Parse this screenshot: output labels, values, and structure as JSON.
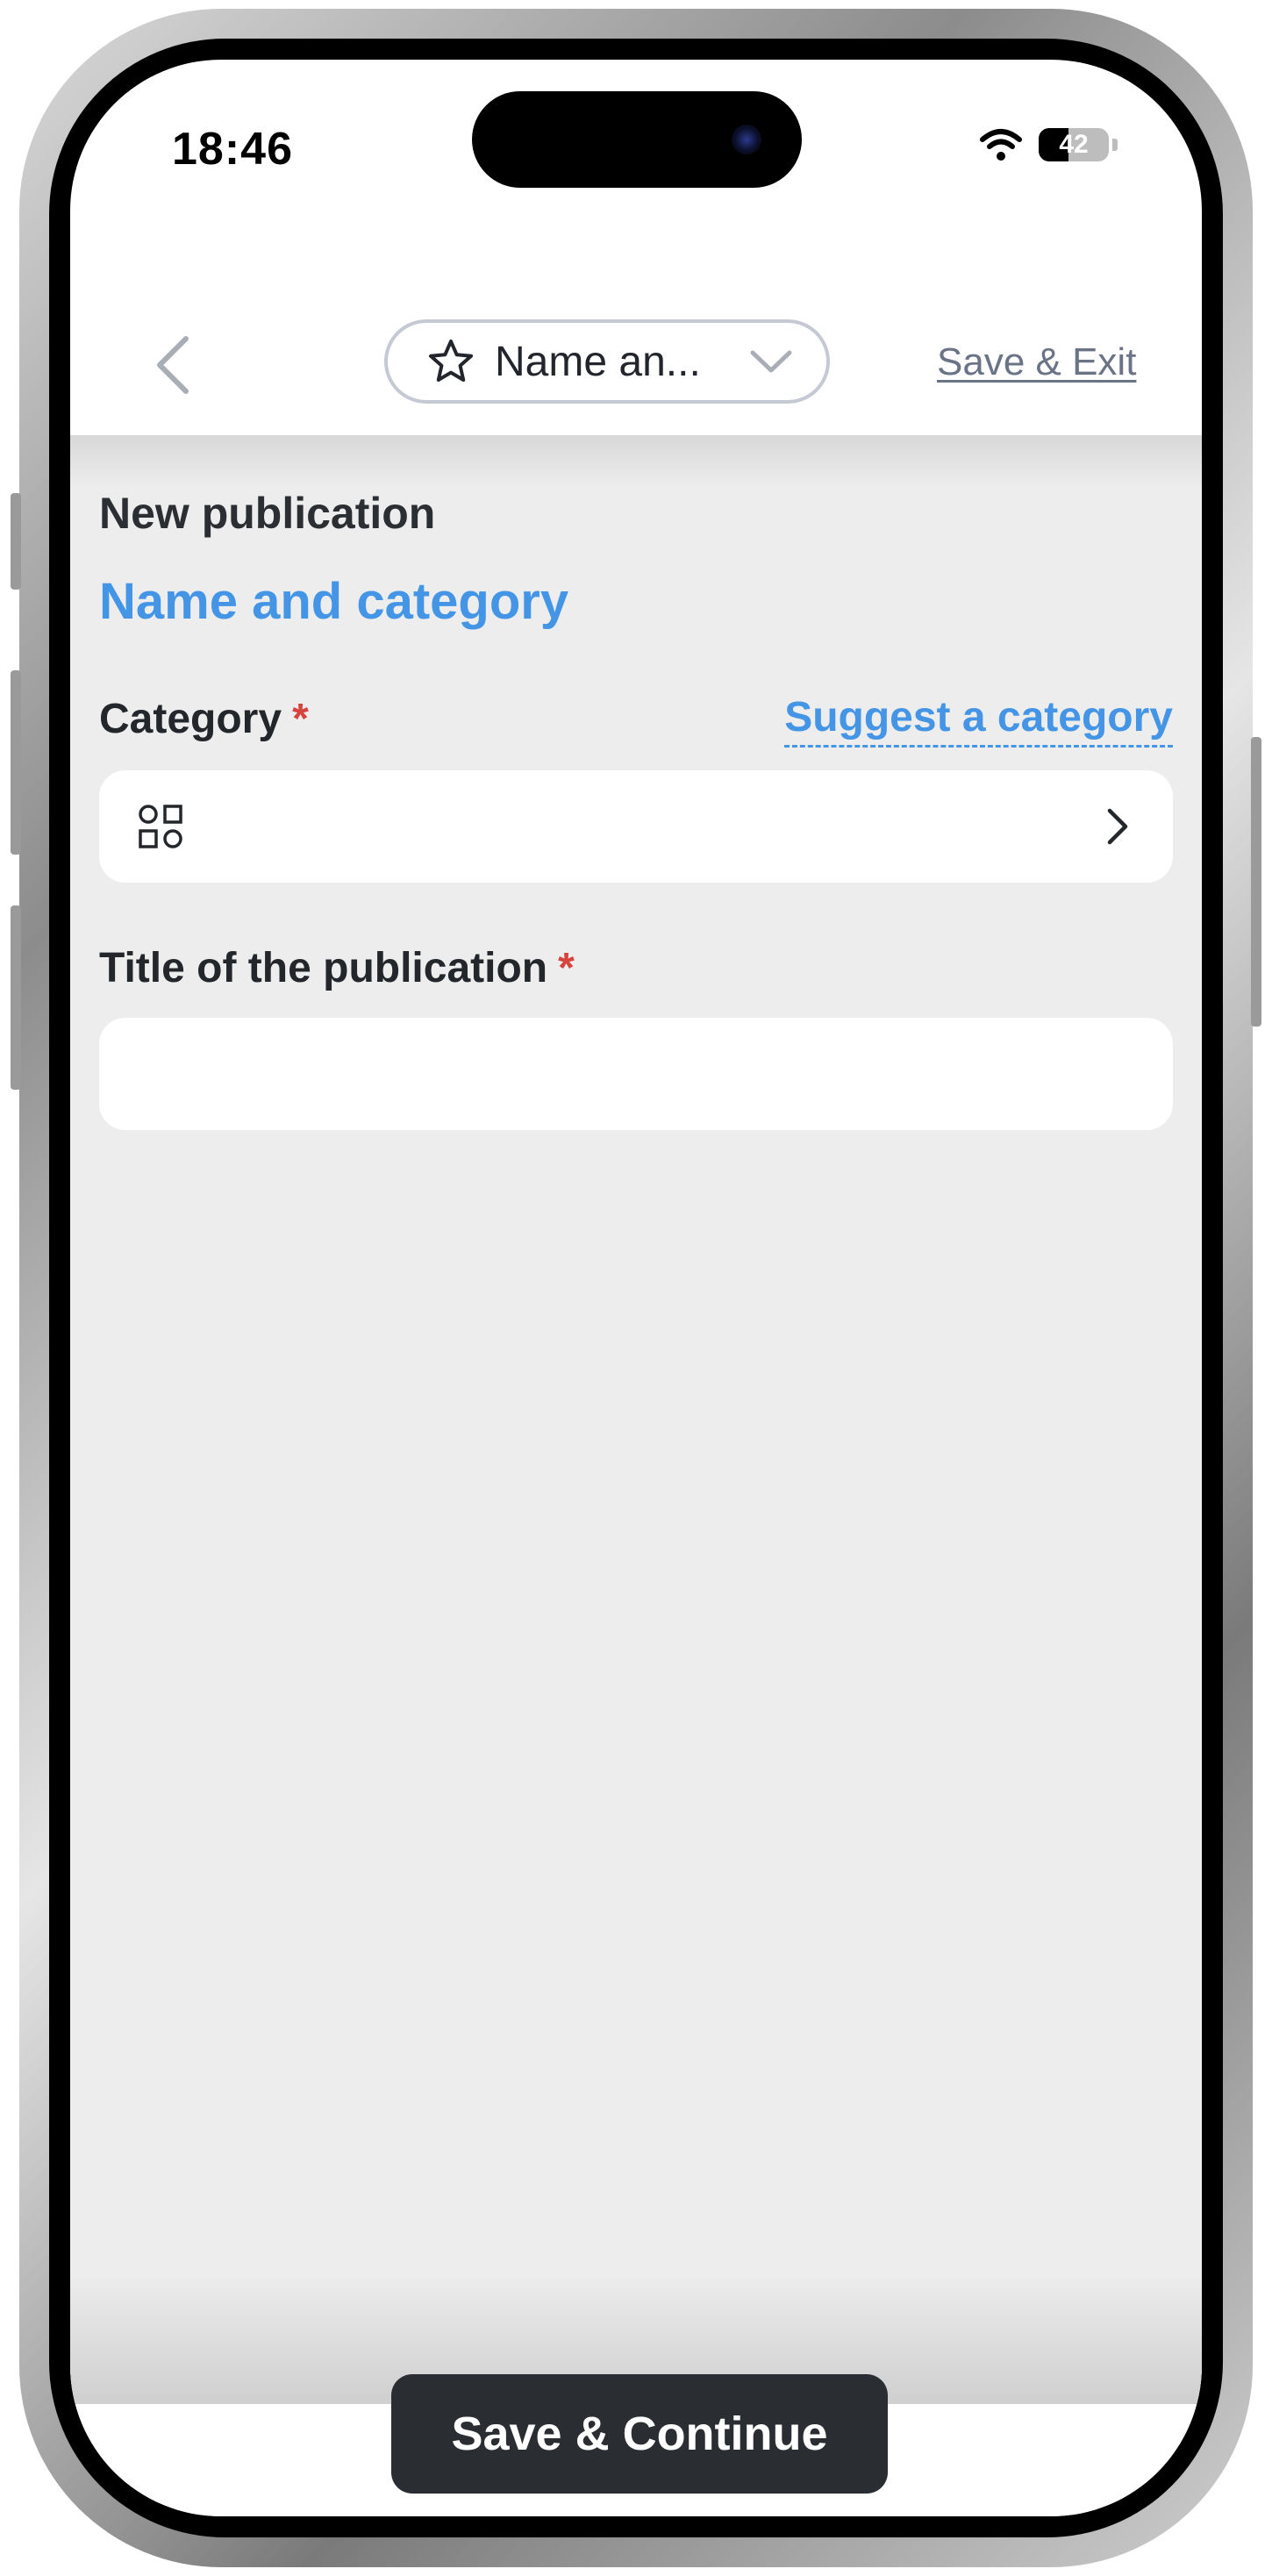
{
  "status_bar": {
    "time": "18:46",
    "battery_level": "42",
    "icons": [
      "wifi-icon",
      "battery-icon"
    ]
  },
  "header": {
    "back_icon": "chevron-left-icon",
    "step_selector": {
      "icon": "star-icon",
      "label": "Name an...",
      "dropdown_icon": "chevron-down-icon"
    },
    "save_exit_label": "Save & Exit"
  },
  "main": {
    "overline": "New publication",
    "section_title": "Name and category",
    "category": {
      "label": "Category",
      "required_mark": "*",
      "suggest_link": "Suggest a category",
      "value": "",
      "icon": "grid-shapes-icon",
      "chevron_icon": "chevron-right-icon"
    },
    "title_field": {
      "label": "Title of the publication",
      "required_mark": "*",
      "value": ""
    }
  },
  "footer": {
    "primary_button": "Save & Continue"
  },
  "colors": {
    "accent": "#4595e6",
    "required": "#d7443e",
    "button_bg": "#2a2d32",
    "content_bg": "#ededee",
    "link_muted": "#6b7487"
  }
}
